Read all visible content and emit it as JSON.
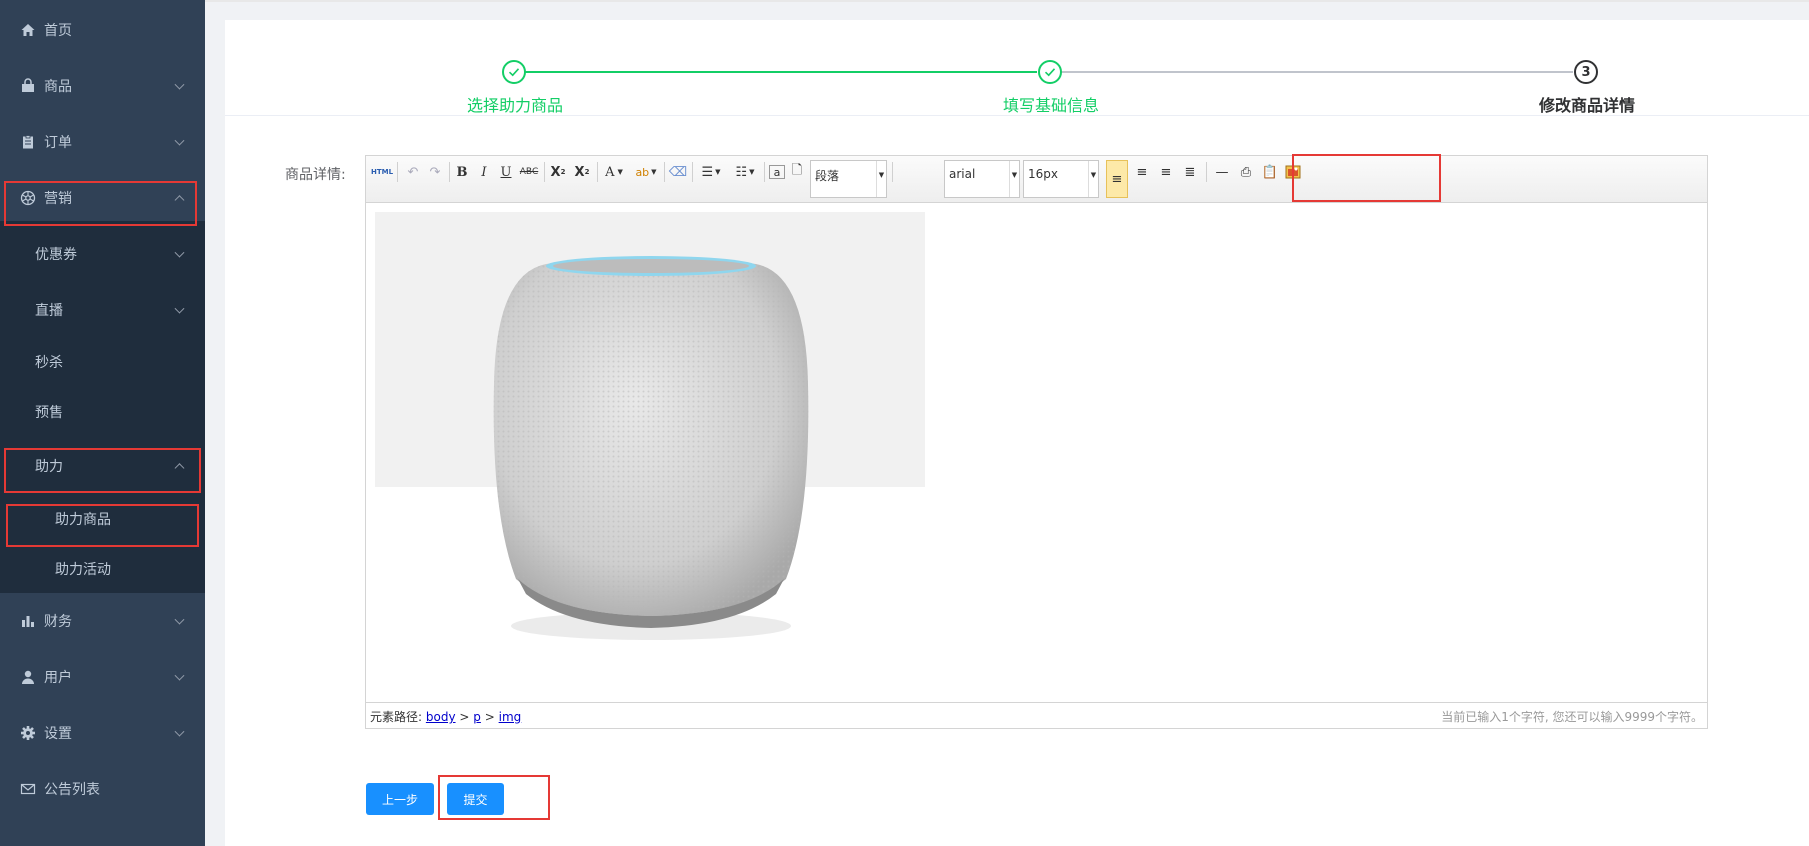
{
  "sidebar": {
    "items": [
      {
        "label": "首页",
        "icon": "home-icon"
      },
      {
        "label": "商品",
        "icon": "bag-icon"
      },
      {
        "label": "订单",
        "icon": "clipboard-icon"
      },
      {
        "label": "营销",
        "icon": "aperture-icon"
      },
      {
        "label": "财务",
        "icon": "bar-chart-icon"
      },
      {
        "label": "用户",
        "icon": "user-icon"
      },
      {
        "label": "设置",
        "icon": "gear-icon"
      },
      {
        "label": "公告列表",
        "icon": "mail-icon"
      }
    ],
    "marketing_sub": [
      {
        "label": "优惠券"
      },
      {
        "label": "直播"
      },
      {
        "label": "秒杀"
      },
      {
        "label": "预售"
      },
      {
        "label": "助力"
      }
    ],
    "assist_sub": [
      {
        "label": "助力商品"
      },
      {
        "label": "助力活动"
      }
    ]
  },
  "steps": [
    {
      "index": "1",
      "title": "选择助力商品",
      "status": "done"
    },
    {
      "index": "2",
      "title": "填写基础信息",
      "status": "done"
    },
    {
      "index": "3",
      "title": "修改商品详情",
      "status": "active"
    }
  ],
  "form": {
    "label": "商品详情:"
  },
  "editor": {
    "toolbar": {
      "html": "HTML",
      "paragraph": "段落",
      "font": "arial",
      "size": "16px"
    },
    "status": {
      "path_label": "元素路径:",
      "path": [
        "body",
        "p",
        "img"
      ],
      "sep": ">",
      "counter": "当前已输入1个字符, 您还可以输入9999个字符。"
    },
    "image": {
      "alt": "smart-speaker-image"
    }
  },
  "buttons": {
    "prev": "上一步",
    "submit": "提交"
  },
  "colors": {
    "sidebar_bg": "#304156",
    "submenu_bg": "#1f2d3d",
    "success": "#13ce66",
    "primary": "#1890ff",
    "highlight": "#e53935"
  }
}
